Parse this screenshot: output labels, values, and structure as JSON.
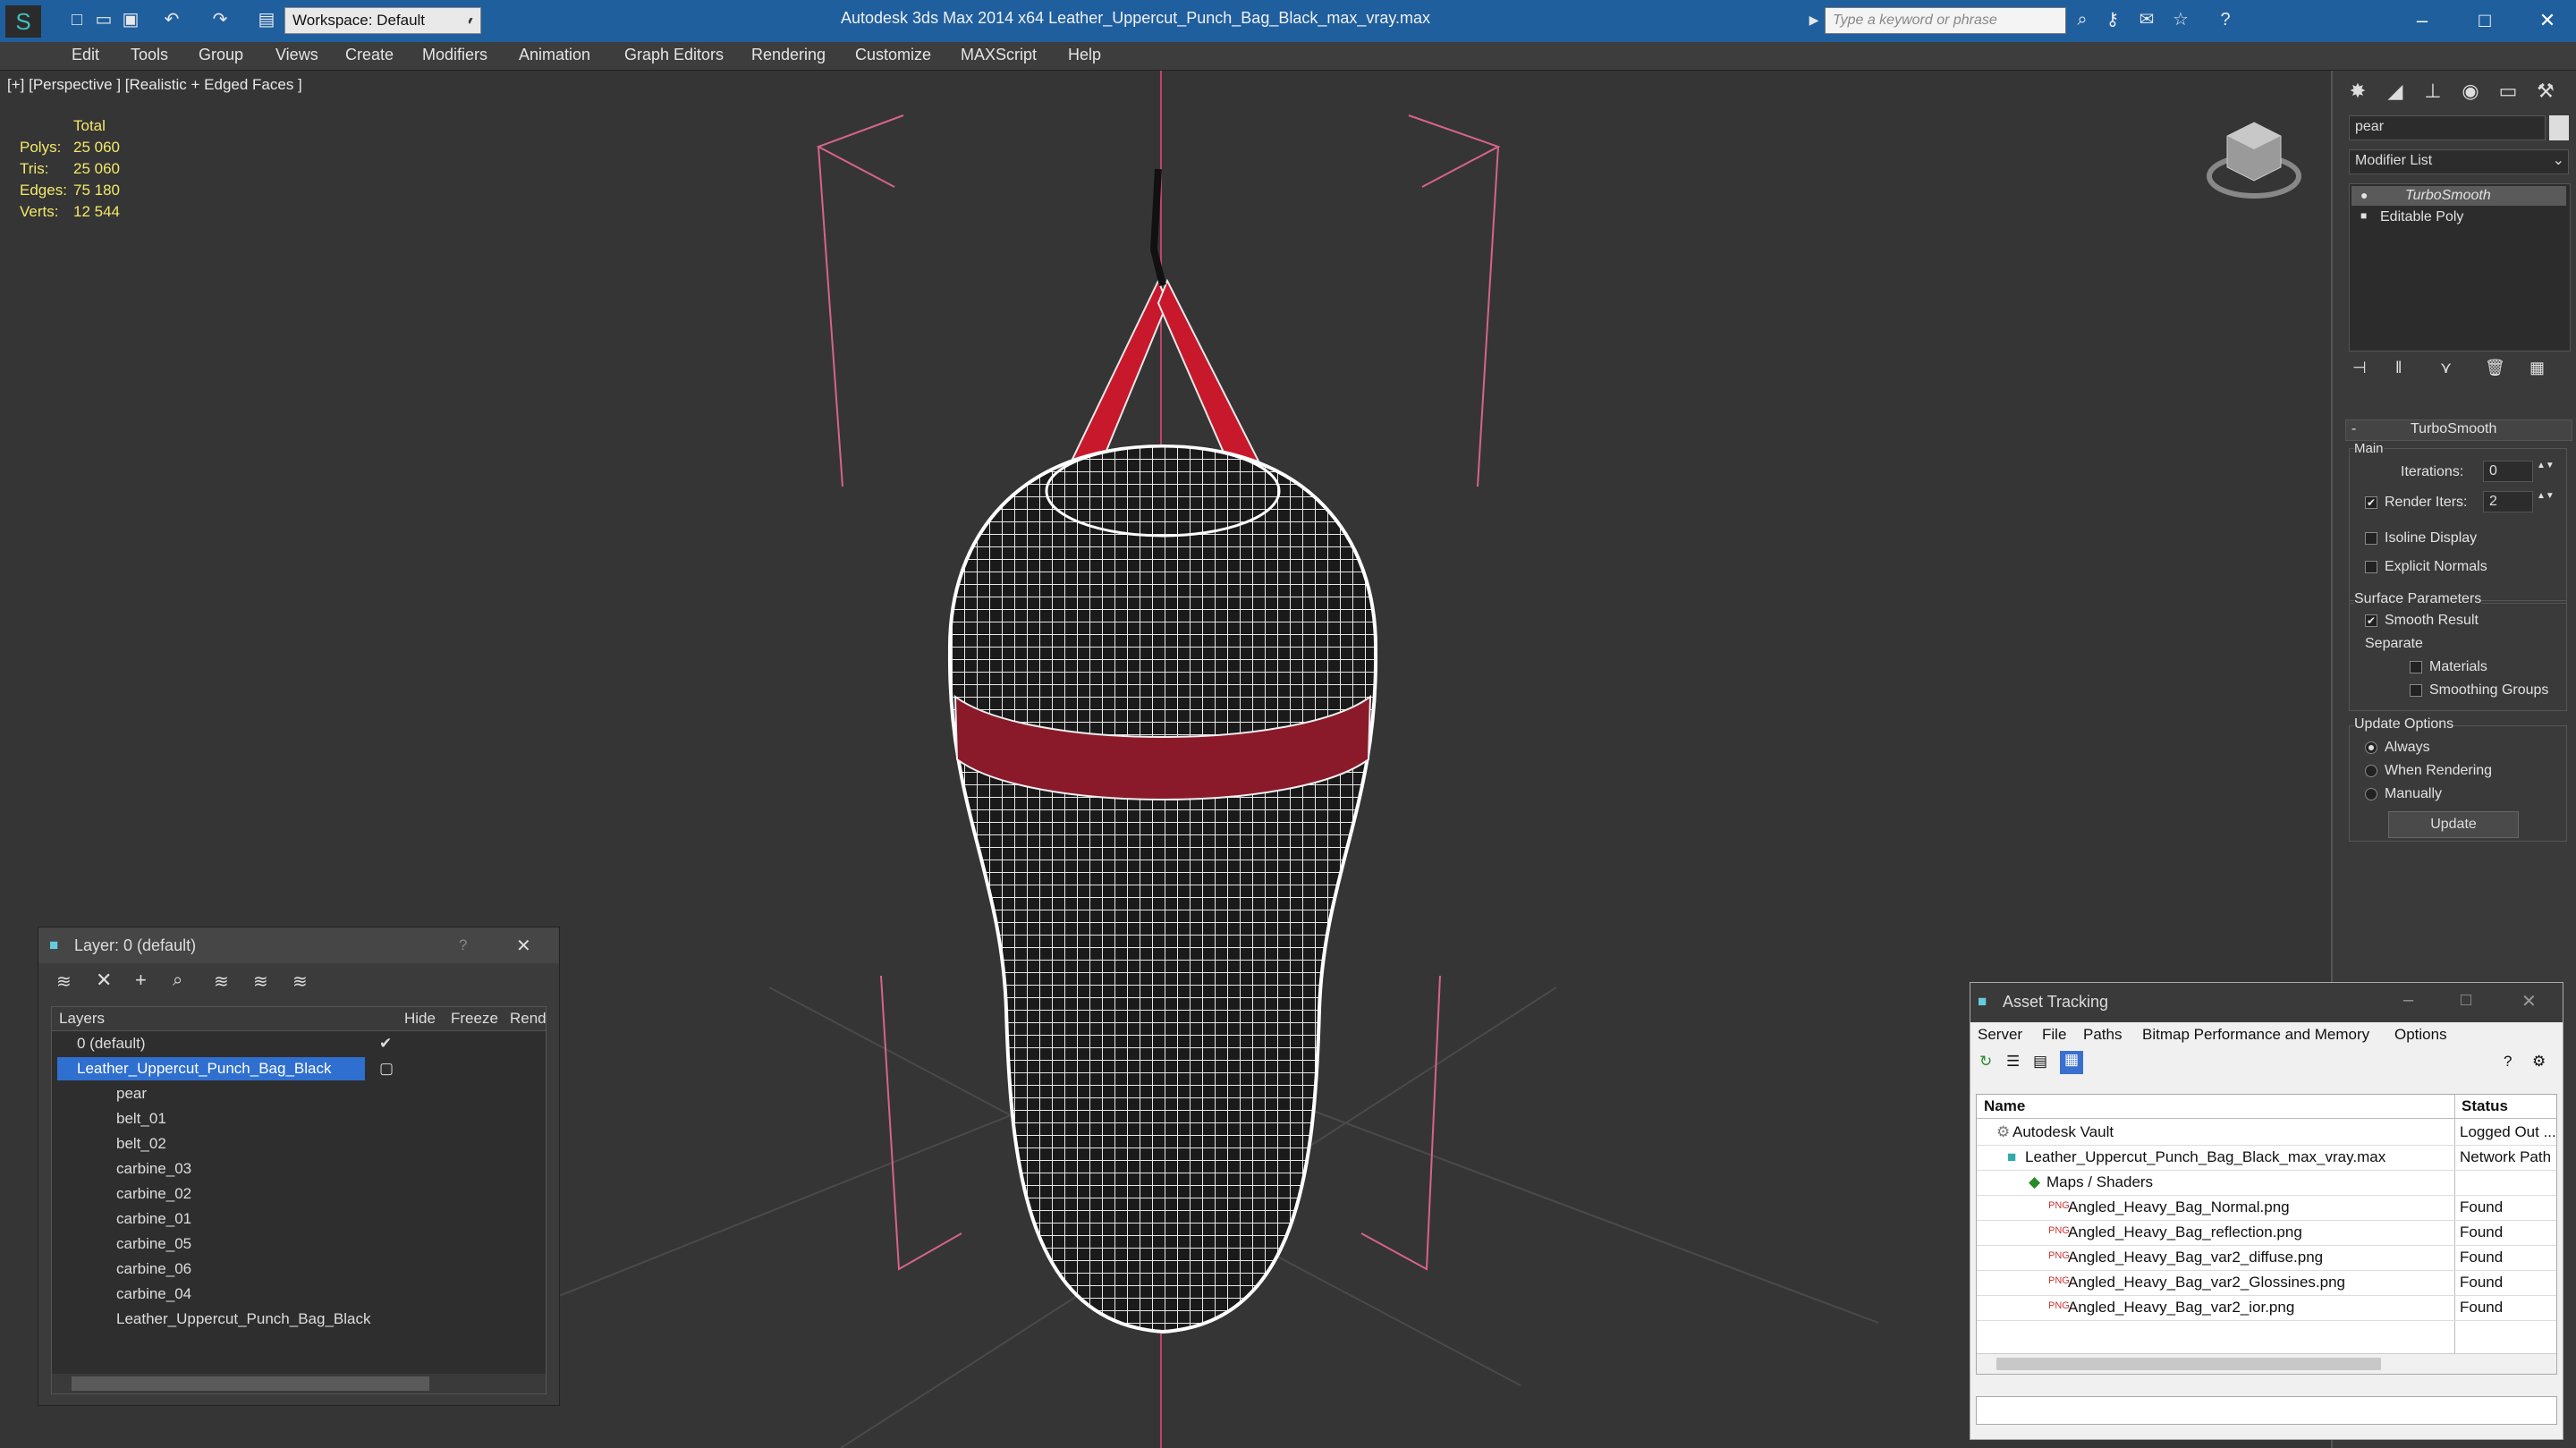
{
  "titlebar": {
    "title": "Autodesk 3ds Max  2014 x64      Leather_Uppercut_Punch_Bag_Black_max_vray.max",
    "workspace": "Workspace: Default",
    "search_placeholder": "Type a keyword or phrase",
    "accent": "#1f5f9e"
  },
  "menu": [
    "Edit",
    "Tools",
    "Group",
    "Views",
    "Create",
    "Modifiers",
    "Animation",
    "Graph Editors",
    "Rendering",
    "Customize",
    "MAXScript",
    "Help"
  ],
  "viewport": {
    "label": "[+] [Perspective ] [Realistic + Edged Faces ]",
    "stats": {
      "total": "Total",
      "polys_label": "Polys:",
      "polys": "25 060",
      "tris_label": "Tris:",
      "tris": "25 060",
      "edges_label": "Edges:",
      "edges": "75 180",
      "verts_label": "Verts:",
      "verts": "12 544"
    }
  },
  "command_panel": {
    "object_name": "pear",
    "modifier_list": "Modifier List",
    "stack": [
      "TurboSmooth",
      "Editable Poly"
    ],
    "rollout_title": "TurboSmooth",
    "main_label": "Main",
    "iterations_label": "Iterations:",
    "iterations": "0",
    "render_iters_label": "Render Iters:",
    "render_iters": "2",
    "isoline": "Isoline Display",
    "explicit_normals": "Explicit Normals",
    "surface_params": "Surface Parameters",
    "smooth_result": "Smooth Result",
    "separate": "Separate",
    "materials": "Materials",
    "smoothing_groups": "Smoothing Groups",
    "update_options": "Update Options",
    "always": "Always",
    "when_rendering": "When Rendering",
    "manually": "Manually",
    "update_button": "Update"
  },
  "layer_dialog": {
    "title": "Layer: 0 (default)",
    "columns": [
      "Layers",
      "Hide",
      "Freeze",
      "Rend"
    ],
    "rows": [
      "0 (default)",
      "Leather_Uppercut_Punch_Bag_Black",
      "pear",
      "belt_01",
      "belt_02",
      "carbine_03",
      "carbine_02",
      "carbine_01",
      "carbine_05",
      "carbine_06",
      "carbine_04",
      "Leather_Uppercut_Punch_Bag_Black"
    ]
  },
  "asset_tracking": {
    "title": "Asset Tracking",
    "menu": [
      "Server",
      "File",
      "Paths",
      "Bitmap Performance and Memory",
      "Options"
    ],
    "columns": [
      "Name",
      "Status"
    ],
    "rows": [
      {
        "name": "Autodesk Vault",
        "status": "Logged Out ..."
      },
      {
        "name": "Leather_Uppercut_Punch_Bag_Black_max_vray.max",
        "status": "Network Path"
      },
      {
        "name": "Maps / Shaders",
        "status": ""
      },
      {
        "name": "Angled_Heavy_Bag_Normal.png",
        "status": "Found"
      },
      {
        "name": "Angled_Heavy_Bag_reflection.png",
        "status": "Found"
      },
      {
        "name": "Angled_Heavy_Bag_var2_diffuse.png",
        "status": "Found"
      },
      {
        "name": "Angled_Heavy_Bag_var2_Glossines.png",
        "status": "Found"
      },
      {
        "name": "Angled_Heavy_Bag_var2_ior.png",
        "status": "Found"
      }
    ]
  }
}
